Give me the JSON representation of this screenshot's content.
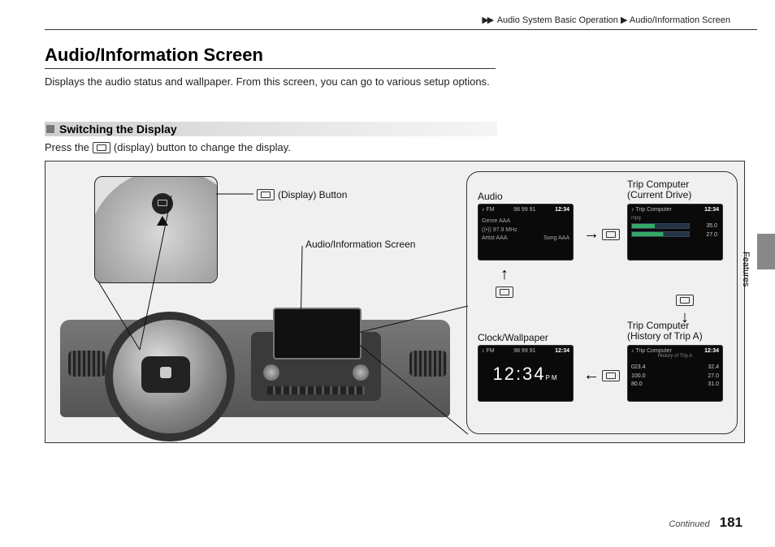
{
  "breadcrumb": {
    "arrows": "▶▶",
    "level1": "Audio System Basic Operation",
    "sep": "▶",
    "level2": "Audio/Information Screen"
  },
  "title": "Audio/Information Screen",
  "intro": "Displays the audio status and wallpaper. From this screen, you can go to various setup options.",
  "section1": {
    "heading": "Switching the Display",
    "instruction_pre": "Press the",
    "instruction_post": "(display) button to change the display."
  },
  "callouts": {
    "display_button": "(Display) Button",
    "info_screen": "Audio/Information Screen"
  },
  "cycle": {
    "audio": {
      "label": "Audio",
      "band": "FM",
      "signal": "98 99 91",
      "time": "12:34",
      "line1": "Genre AAA",
      "line2": "97.9 MHz",
      "line3_left": "Artist AAA",
      "line3_right": "Song AAA"
    },
    "trip_current": {
      "label": "Trip Computer\n(Current Drive)",
      "title": "Trip Computer",
      "time": "12:34",
      "readings": [
        "35.0",
        "27.0"
      ]
    },
    "trip_history": {
      "label": "Trip Computer\n(History of Trip A)",
      "title": "Trip Computer",
      "subtitle": "History of Trip A",
      "time": "12:34",
      "rows": [
        {
          "a": "023.4",
          "b": "32.4"
        },
        {
          "a": "100.0",
          "b": "27.0"
        },
        {
          "a": "80.0",
          "b": "31.0"
        }
      ]
    },
    "clock": {
      "label": "Clock/Wallpaper",
      "band": "FM",
      "signal": "98 99 91",
      "time_small": "12:34",
      "time_big": "12:34",
      "ampm": "PM"
    }
  },
  "side_label": "Features",
  "footer": {
    "continued": "Continued",
    "page": "181"
  }
}
